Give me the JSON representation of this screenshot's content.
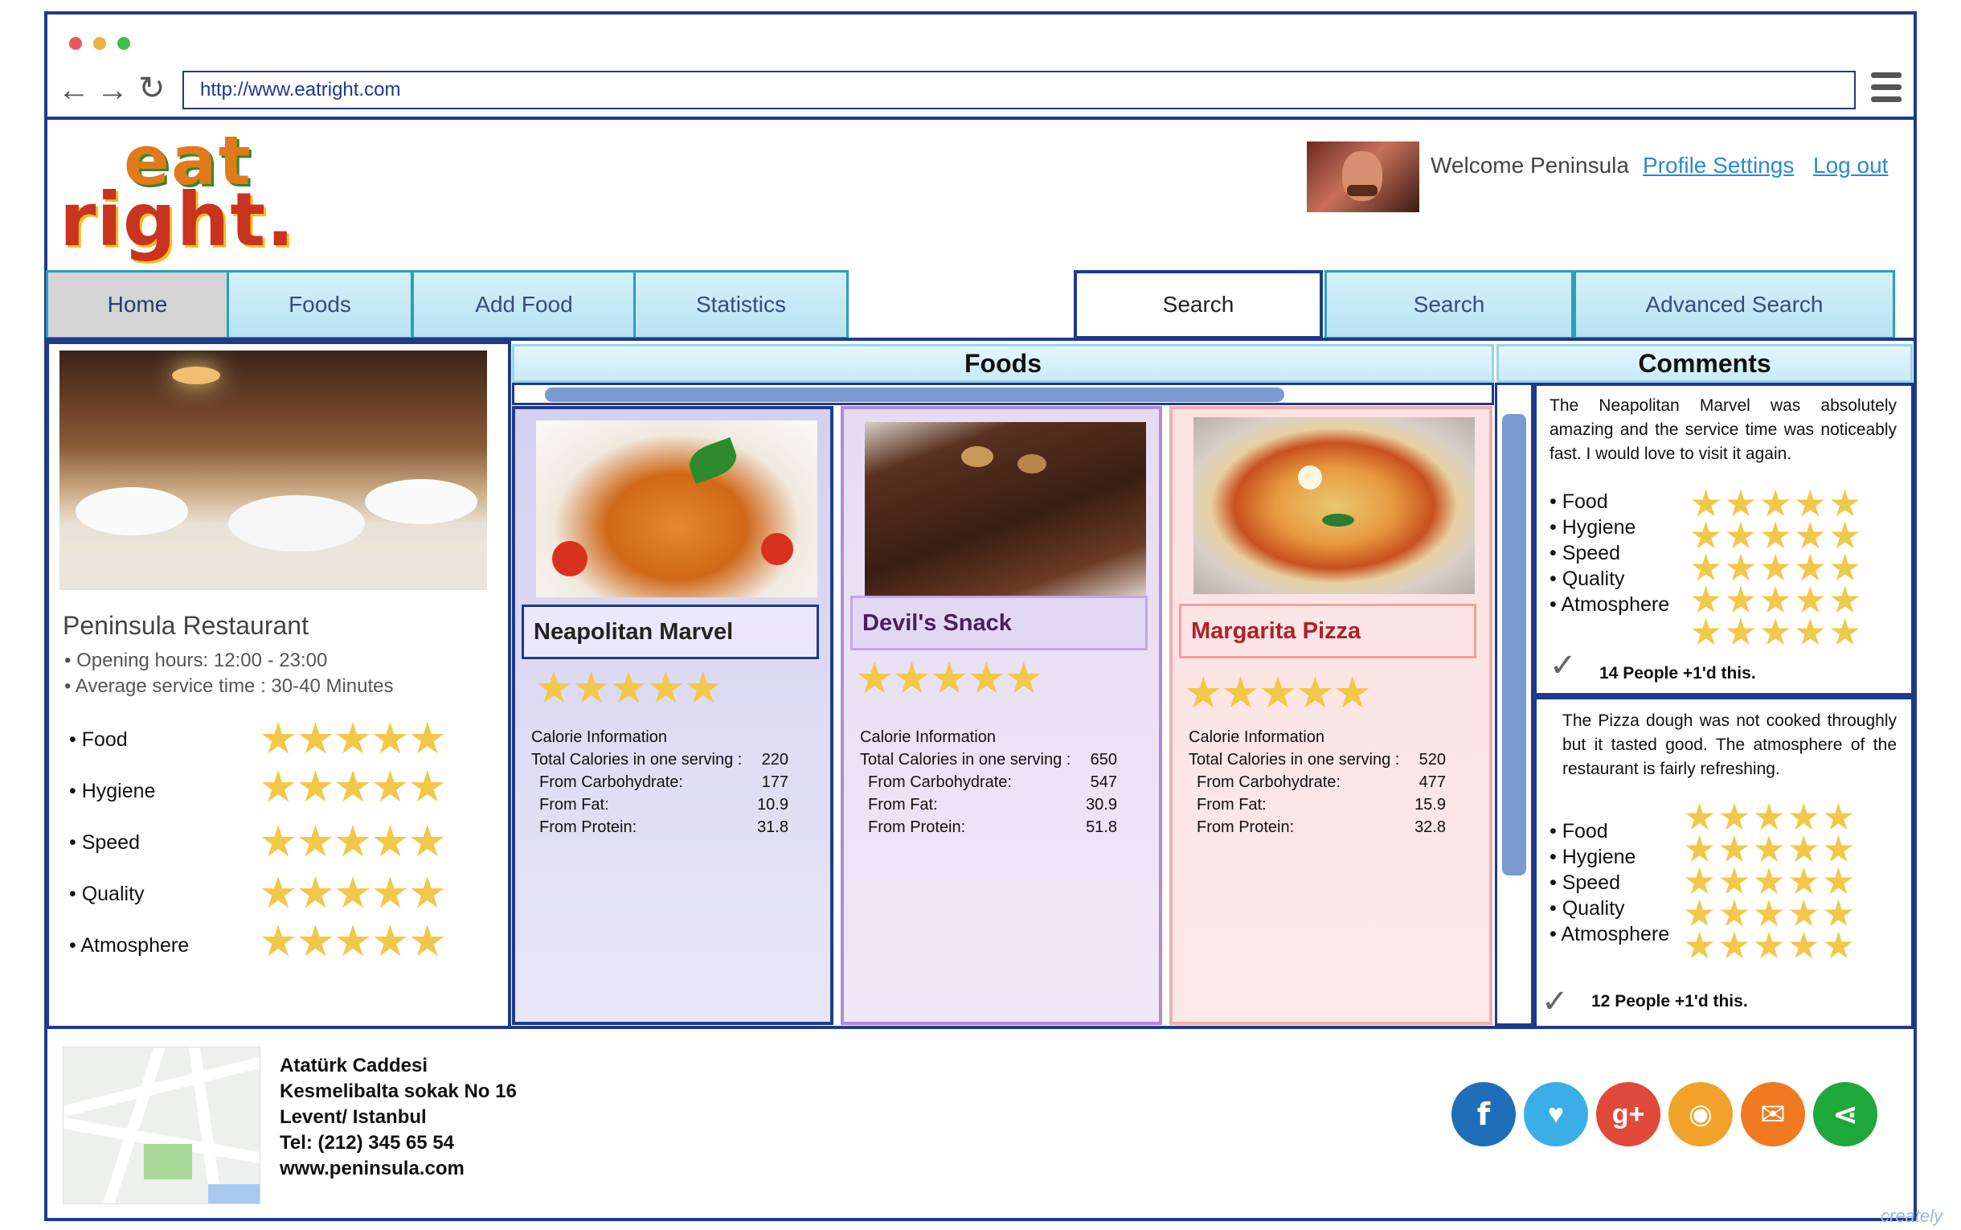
{
  "browser": {
    "url": "http://www.eatright.com"
  },
  "header": {
    "logo_line1": "eat",
    "logo_line2": "right.",
    "welcome": "Welcome Peninsula",
    "profile_settings": "Profile Settings",
    "logout": "Log out"
  },
  "nav": {
    "home": "Home",
    "foods": "Foods",
    "add_food": "Add Food",
    "statistics": "Statistics",
    "search_field": "Search",
    "search_button": "Search",
    "advanced_search": "Advanced Search"
  },
  "restaurant": {
    "name": "Peninsula Restaurant",
    "opening_hours": "Opening hours: 12:00 - 23:00",
    "service_time": "Average service time : 30-40 Minutes",
    "ratings": [
      {
        "label": "Food",
        "stars": 5
      },
      {
        "label": "Hygiene",
        "stars": 5
      },
      {
        "label": "Speed",
        "stars": 5
      },
      {
        "label": "Quality",
        "stars": 5
      },
      {
        "label": "Atmosphere",
        "stars": 5
      }
    ]
  },
  "foods_section": {
    "title": "Foods",
    "items": [
      {
        "name": "Neapolitan Marvel",
        "stars": 5,
        "calorie_title": "Calorie Information",
        "total_label": "Total Calories in one serving :",
        "total": "220",
        "carb_label": "From Carbohydrate:",
        "carb": "177",
        "fat_label": "From Fat:",
        "fat": "10.9",
        "protein_label": "From Protein:",
        "protein": "31.8"
      },
      {
        "name": "Devil's Snack",
        "stars": 5,
        "calorie_title": "Calorie Information",
        "total_label": "Total Calories in one serving :",
        "total": "650",
        "carb_label": "From Carbohydrate:",
        "carb": "547",
        "fat_label": "From Fat:",
        "fat": "30.9",
        "protein_label": "From Protein:",
        "protein": "51.8"
      },
      {
        "name": "Margarita Pizza",
        "stars": 5,
        "calorie_title": "Calorie Information",
        "total_label": "Total Calories in one serving :",
        "total": "520",
        "carb_label": "From Carbohydrate:",
        "carb": "477",
        "fat_label": "From Fat:",
        "fat": "15.9",
        "protein_label": "From Protein:",
        "protein": "32.8"
      }
    ]
  },
  "comments_section": {
    "title": "Comments",
    "items": [
      {
        "text": "The Neapolitan Marvel was absolutely amazing and the service time was noticeably fast. I would love to visit it again.",
        "labels": [
          "Food",
          "Hygiene",
          "Speed",
          "Quality",
          "Atmosphere"
        ],
        "likes": "14 People +1'd this."
      },
      {
        "text": "The Pizza dough was not cooked throughly but it tasted good. The atmosphere of the restaurant is fairly refreshing.",
        "labels": [
          "Food",
          "Hygiene",
          "Speed",
          "Quality",
          "Atmosphere"
        ],
        "likes": "12 People +1'd this."
      }
    ]
  },
  "footer": {
    "address_line1": "Atatürk Caddesi",
    "address_line2": "Kesmelibalta sokak No 16",
    "address_line3": "Levent/ Istanbul",
    "phone": "Tel: (212) 345 65 54",
    "website": "www.peninsula.com",
    "social": [
      {
        "name": "facebook",
        "glyph": "f",
        "color": "#1e6fb8"
      },
      {
        "name": "twitter",
        "glyph": "🐦",
        "color": "#3aaee6"
      },
      {
        "name": "google-plus",
        "glyph": "g+",
        "color": "#e04a3a"
      },
      {
        "name": "rss",
        "glyph": "◉",
        "color": "#f0a22a"
      },
      {
        "name": "email",
        "glyph": "✉",
        "color": "#f07a22"
      },
      {
        "name": "share",
        "glyph": "⋖",
        "color": "#1ea83a"
      }
    ]
  },
  "watermark": "creately"
}
